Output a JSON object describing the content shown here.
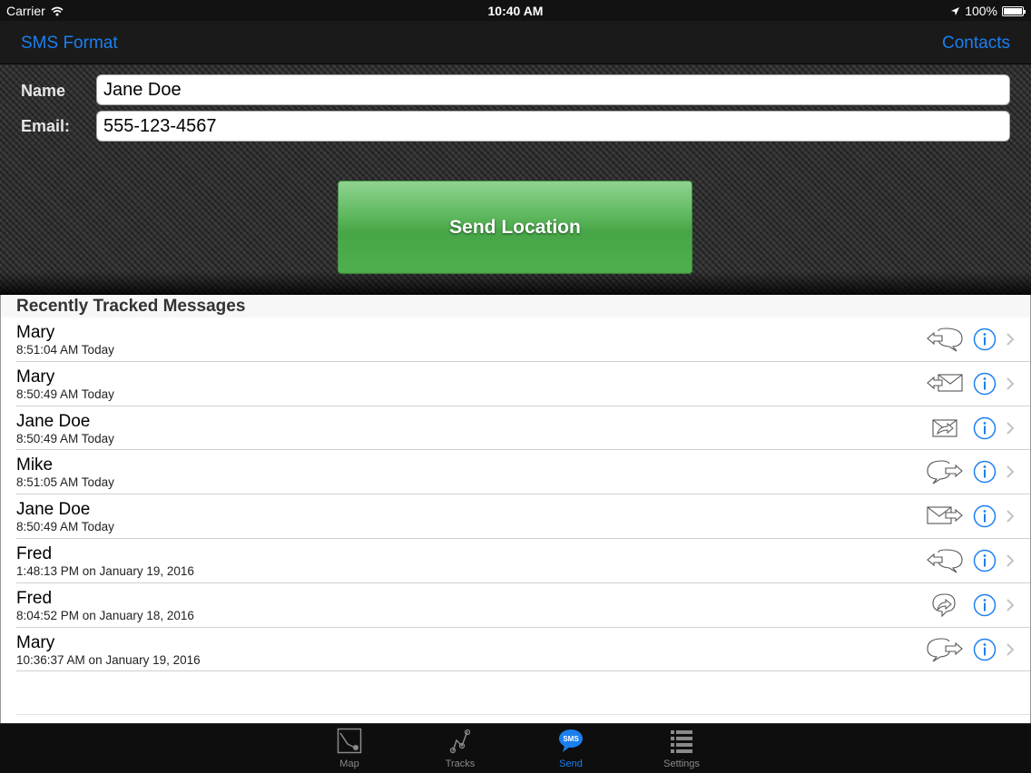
{
  "status": {
    "carrier": "Carrier",
    "time": "10:40 AM",
    "battery": "100%"
  },
  "nav": {
    "left": "SMS Format",
    "right": "Contacts"
  },
  "form": {
    "name_label": "Name",
    "name_value": "Jane Doe",
    "email_label": "Email:",
    "email_value": "555-123-4567",
    "send_label": "Send Location"
  },
  "list": {
    "header": "Recently Tracked Messages",
    "items": [
      {
        "name": "Mary",
        "time": "8:51:04 AM Today",
        "icon": "speech-bubble-left-arrow-icon"
      },
      {
        "name": "Mary",
        "time": "8:50:49 AM Today",
        "icon": "envelope-left-arrow-icon"
      },
      {
        "name": "Jane Doe",
        "time": "8:50:49 AM Today",
        "icon": "envelope-forward-icon"
      },
      {
        "name": "Mike",
        "time": "8:51:05 AM Today",
        "icon": "speech-bubble-right-arrow-icon"
      },
      {
        "name": "Jane Doe",
        "time": "8:50:49 AM Today",
        "icon": "envelope-right-arrow-icon"
      },
      {
        "name": "Fred",
        "time": "1:48:13 PM on January 19, 2016",
        "icon": "speech-bubble-left-arrow-icon"
      },
      {
        "name": "Fred",
        "time": "8:04:52 PM on January 18, 2016",
        "icon": "speech-bubble-forward-icon"
      },
      {
        "name": "Mary",
        "time": "10:36:37 AM on January 19, 2016",
        "icon": "speech-bubble-right-arrow-icon"
      }
    ]
  },
  "tabs": [
    {
      "label": "Map",
      "icon": "map-icon",
      "active": false
    },
    {
      "label": "Tracks",
      "icon": "tracks-icon",
      "active": false
    },
    {
      "label": "Send",
      "icon": "sms-icon",
      "active": true
    },
    {
      "label": "Settings",
      "icon": "settings-list-icon",
      "active": false
    }
  ],
  "colors": {
    "accent": "#1b7ff0",
    "send_green": "#4fb04f",
    "icon_gray": "#8a8a8a"
  }
}
